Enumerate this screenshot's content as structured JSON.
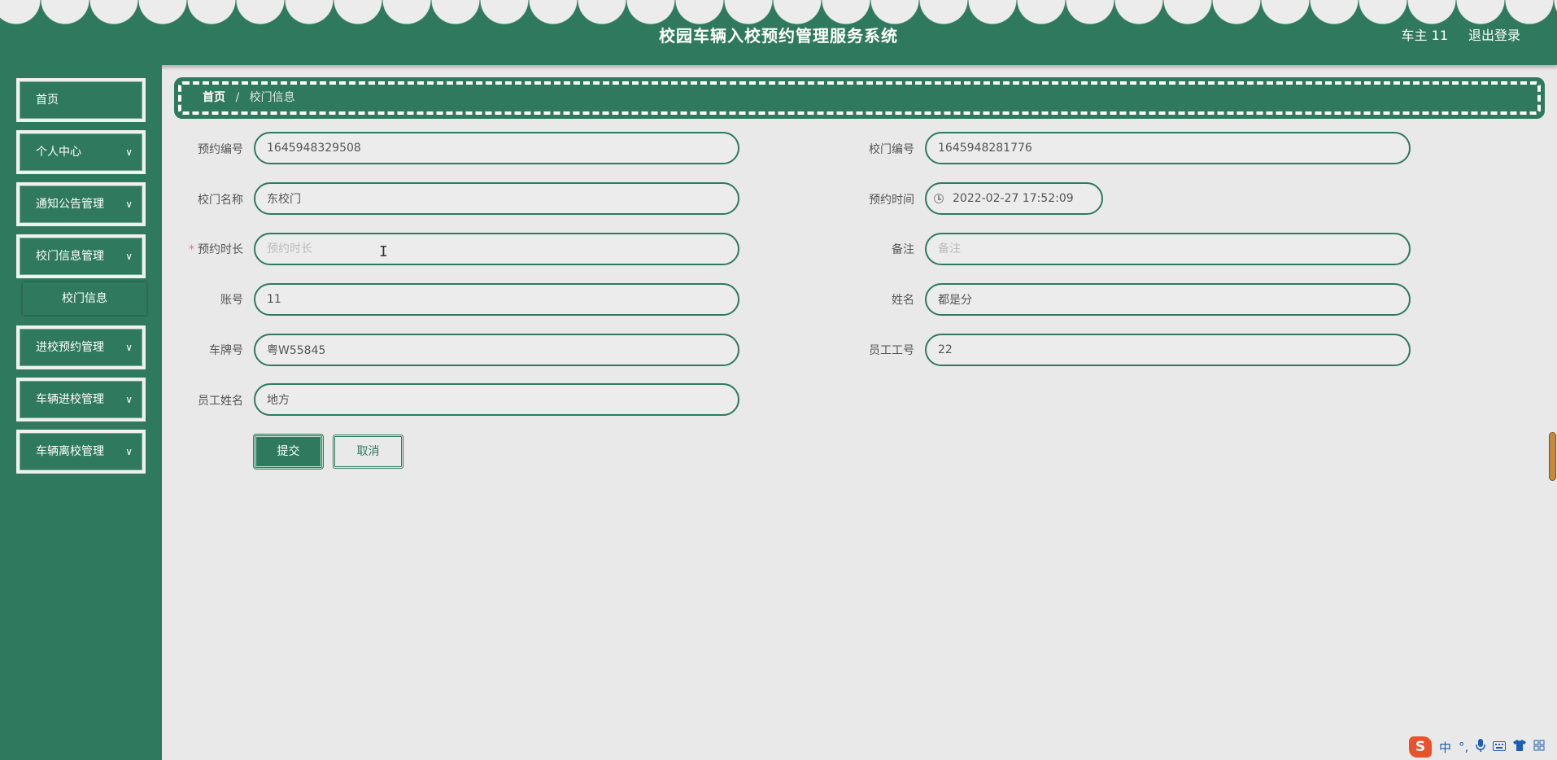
{
  "header": {
    "title": "校园车辆入校预约管理服务系统",
    "user": "车主 11",
    "logout": "退出登录"
  },
  "sidebar": {
    "items": [
      {
        "label": "首页",
        "has_children": false
      },
      {
        "label": "个人中心",
        "has_children": true
      },
      {
        "label": "通知公告管理",
        "has_children": true
      },
      {
        "label": "校门信息管理",
        "has_children": true
      },
      {
        "label": "进校预约管理",
        "has_children": true
      },
      {
        "label": "车辆进校管理",
        "has_children": true
      },
      {
        "label": "车辆离校管理",
        "has_children": true
      }
    ],
    "submenu": {
      "label": "校门信息"
    }
  },
  "breadcrumb": {
    "home": "首页",
    "separator": "/",
    "current": "校门信息"
  },
  "form": {
    "fields": {
      "booking_no": {
        "label": "预约编号",
        "value": "1645948329508"
      },
      "gate_no": {
        "label": "校门编号",
        "value": "1645948281776"
      },
      "gate_name": {
        "label": "校门名称",
        "value": "东校门"
      },
      "booking_time": {
        "label": "预约时间",
        "value": "2022-02-27 17:52:09"
      },
      "duration": {
        "label": "预约时长",
        "value": "",
        "placeholder": "预约时长",
        "required": "*"
      },
      "remark": {
        "label": "备注",
        "value": "",
        "placeholder": "备注"
      },
      "account": {
        "label": "账号",
        "value": "11"
      },
      "name": {
        "label": "姓名",
        "value": "都是分"
      },
      "plate_no": {
        "label": "车牌号",
        "value": "粤W55845"
      },
      "staff_no": {
        "label": "员工工号",
        "value": "22"
      },
      "staff_name": {
        "label": "员工姓名",
        "value": "地方"
      }
    },
    "submit_label": "提交",
    "cancel_label": "取消"
  },
  "ime": {
    "logo": "S",
    "mode": "中",
    "punct": "°,"
  },
  "colors": {
    "primary": "#2f7a5e",
    "background": "#e9e9e9",
    "required": "#f56c6c"
  }
}
